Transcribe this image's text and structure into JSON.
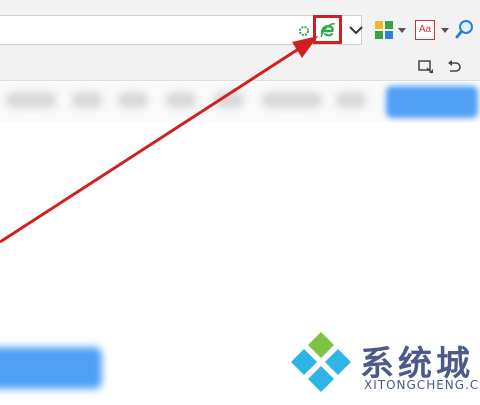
{
  "toolbar": {
    "gear_icon": "refresh-gear-icon",
    "ie_icon": "ie-compat-mode-icon",
    "dropdown_icon": "chevron-down-icon",
    "apps_icon": "apps-grid-icon",
    "translate_label": "Aa",
    "search_icon": "magnifier-icon"
  },
  "row2": {
    "icons": [
      "screenshot-icon",
      "undo-icon"
    ]
  },
  "watermark": {
    "brand": "系统城",
    "domain": "XITONGCHENG.COM"
  },
  "colors": {
    "highlight_red": "#d21f1f",
    "ie_green": "#2fa84f",
    "blue": "#4f9ff5",
    "watermark_blue": "#4a5a8a"
  }
}
